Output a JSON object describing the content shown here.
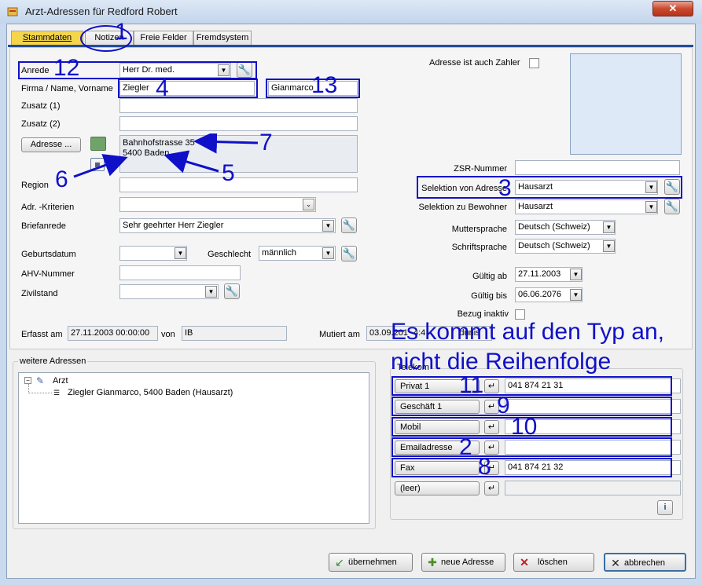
{
  "window": {
    "title": "Arzt-Adressen für Redford Robert",
    "close_glyph": "✕"
  },
  "tabs": [
    {
      "label": "Stammdaten",
      "active": true
    },
    {
      "label": "Notizen",
      "active": false
    },
    {
      "label": "Freie Felder",
      "active": false
    },
    {
      "label": "Fremdsystem",
      "active": false
    }
  ],
  "form": {
    "anrede_label": "Anrede",
    "anrede_value": "Herr Dr. med.",
    "firma_label": "Firma / Name, Vorname",
    "name_value": "Ziegler",
    "vorname_value": "Gianmarco",
    "zusatz1_label": "Zusatz (1)",
    "zusatz1_value": "",
    "zusatz2_label": "Zusatz (2)",
    "zusatz2_value": "",
    "adresse_button": "Adresse ...",
    "address_line1": "Bahnhofstrasse 35",
    "address_line2": "5400 Baden",
    "region_label": "Region",
    "region_value": "",
    "kriterien_label": "Adr. -Kriterien",
    "kriterien_value": "",
    "briefanrede_label": "Briefanrede",
    "briefanrede_value": "Sehr geehrter Herr Ziegler",
    "geburtsdatum_label": "Geburtsdatum",
    "geburtsdatum_value": "",
    "geschlecht_label": "Geschlecht",
    "geschlecht_value": "männlich",
    "ahv_label": "AHV-Nummer",
    "ahv_value": "",
    "zivilstand_label": "Zivilstand",
    "zivilstand_value": "",
    "zahler_label": "Adresse ist auch Zahler",
    "zsr_label": "ZSR-Nummer",
    "zsr_value": "",
    "selektion_von_label": "Selektion von Adresse",
    "selektion_von_value": "Hausarzt",
    "selektion_zu_label": "Selektion zu Bewohner",
    "selektion_zu_value": "Hausarzt",
    "muttersprache_label": "Muttersprache",
    "muttersprache_value": "Deutsch (Schweiz)",
    "schriftsprache_label": "Schriftsprache",
    "schriftsprache_value": "Deutsch (Schweiz)",
    "gueltig_ab_label": "Gültig ab",
    "gueltig_ab_value": "27.11.2003",
    "gueltig_bis_label": "Gültig bis",
    "gueltig_bis_value": "06.06.2076",
    "bezug_inaktiv_label": "Bezug inaktiv",
    "erfasst_label": "Erfasst am",
    "erfasst_value": "27.11.2003 00:00:00",
    "von_label": "von",
    "erfasst_von_value": "IB",
    "mutiert_label": "Mutiert am",
    "mutiert_value": "03.09.201",
    "mutiert_value_partial": "4:4",
    "mutiert_von_value": "dunis"
  },
  "weitere": {
    "label": "weitere Adressen",
    "tree_root": "Arzt",
    "tree_child": "Ziegler Gianmarco, 5400 Baden (Hausarzt)"
  },
  "telekom": {
    "label": "Telekom",
    "rows": [
      {
        "button": "Privat 1",
        "value": "041 874 21 31"
      },
      {
        "button": "Geschäft 1",
        "value": ""
      },
      {
        "button": "Mobil",
        "value": ""
      },
      {
        "button": "Emailadresse",
        "value": ""
      },
      {
        "button": "Fax",
        "value": "041 874 21 32"
      },
      {
        "button": "(leer)",
        "value": ""
      }
    ]
  },
  "footer": {
    "uebernehmen": "übernehmen",
    "neue_adresse": "neue Adresse",
    "loeschen": "löschen",
    "abbrechen": "abbrechen"
  },
  "annotations": {
    "n1": "1",
    "n2": "2",
    "n3": "3",
    "n4": "4",
    "n5": "5",
    "n6": "6",
    "n7": "7",
    "n8": "8",
    "n9": "9",
    "n10": "10",
    "n11": "11",
    "n12": "12",
    "n13": "13",
    "note_line1": "Es kommt auf den Typ an,",
    "note_line2": "nicht die Reihenfolge"
  },
  "colors": {
    "annotation": "#1010c8",
    "active_tab": "#f5d64a",
    "tab_underline": "#254c9a"
  }
}
